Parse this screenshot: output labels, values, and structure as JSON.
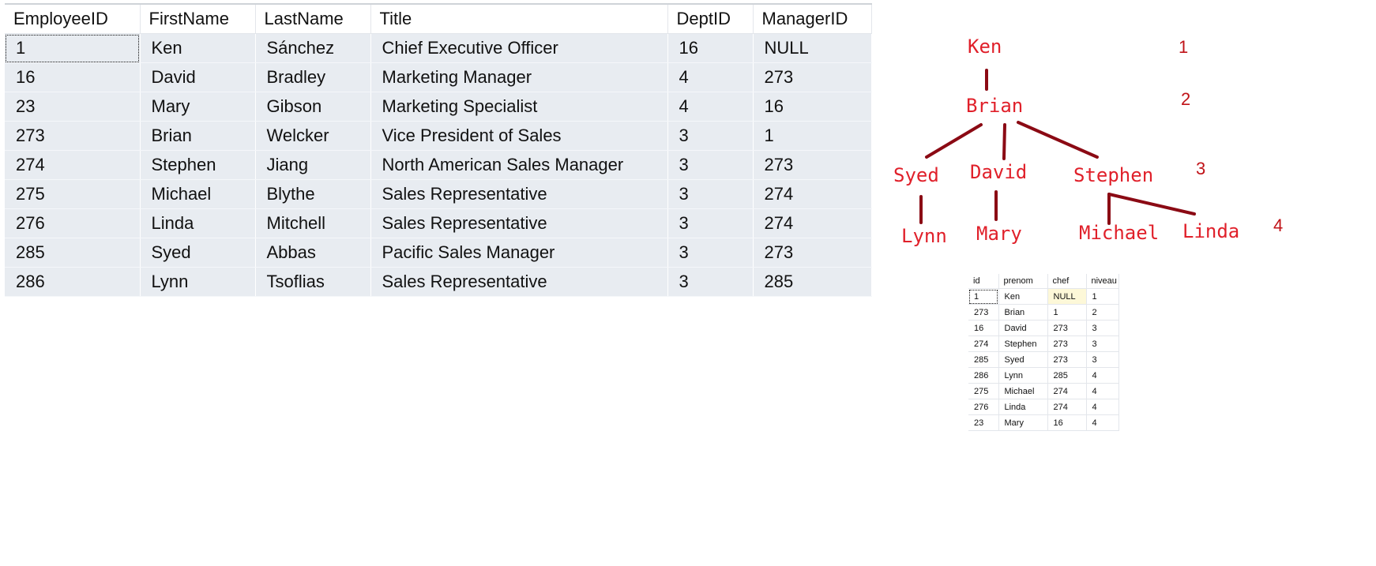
{
  "main_grid": {
    "columns": [
      "EmployeeID",
      "FirstName",
      "LastName",
      "Title",
      "DeptID",
      "ManagerID"
    ],
    "rows": [
      [
        "1",
        "Ken",
        "Sánchez",
        "Chief Executive Officer",
        "16",
        "NULL"
      ],
      [
        "16",
        "David",
        "Bradley",
        "Marketing Manager",
        "4",
        "273"
      ],
      [
        "23",
        "Mary",
        "Gibson",
        "Marketing Specialist",
        "4",
        "16"
      ],
      [
        "273",
        "Brian",
        "Welcker",
        "Vice President of Sales",
        "3",
        "1"
      ],
      [
        "274",
        "Stephen",
        "Jiang",
        "North American Sales Manager",
        "3",
        "273"
      ],
      [
        "275",
        "Michael",
        "Blythe",
        "Sales Representative",
        "3",
        "274"
      ],
      [
        "276",
        "Linda",
        "Mitchell",
        "Sales Representative",
        "3",
        "274"
      ],
      [
        "285",
        "Syed",
        "Abbas",
        "Pacific Sales Manager",
        "3",
        "273"
      ],
      [
        "286",
        "Lynn",
        "Tsoflias",
        "Sales Representative",
        "3",
        "285"
      ]
    ]
  },
  "tree": {
    "nodes": {
      "ken": "Ken",
      "brian": "Brian",
      "syed": "Syed",
      "david": "David",
      "stephen": "Stephen",
      "lynn": "Lynn",
      "mary": "Mary",
      "michael": "Michael",
      "linda": "Linda"
    },
    "levels": [
      "1",
      "2",
      "3",
      "4"
    ],
    "colors": {
      "node_text": "#e0202a",
      "edge": "#8b0a14",
      "level_text": "#c01318"
    }
  },
  "small_grid": {
    "columns": [
      "id",
      "prenom",
      "chef",
      "niveau"
    ],
    "rows": [
      [
        "1",
        "Ken",
        "NULL",
        "1"
      ],
      [
        "273",
        "Brian",
        "1",
        "2"
      ],
      [
        "16",
        "David",
        "273",
        "3"
      ],
      [
        "274",
        "Stephen",
        "273",
        "3"
      ],
      [
        "285",
        "Syed",
        "273",
        "3"
      ],
      [
        "286",
        "Lynn",
        "285",
        "4"
      ],
      [
        "275",
        "Michael",
        "274",
        "4"
      ],
      [
        "276",
        "Linda",
        "274",
        "4"
      ],
      [
        "23",
        "Mary",
        "16",
        "4"
      ]
    ]
  }
}
